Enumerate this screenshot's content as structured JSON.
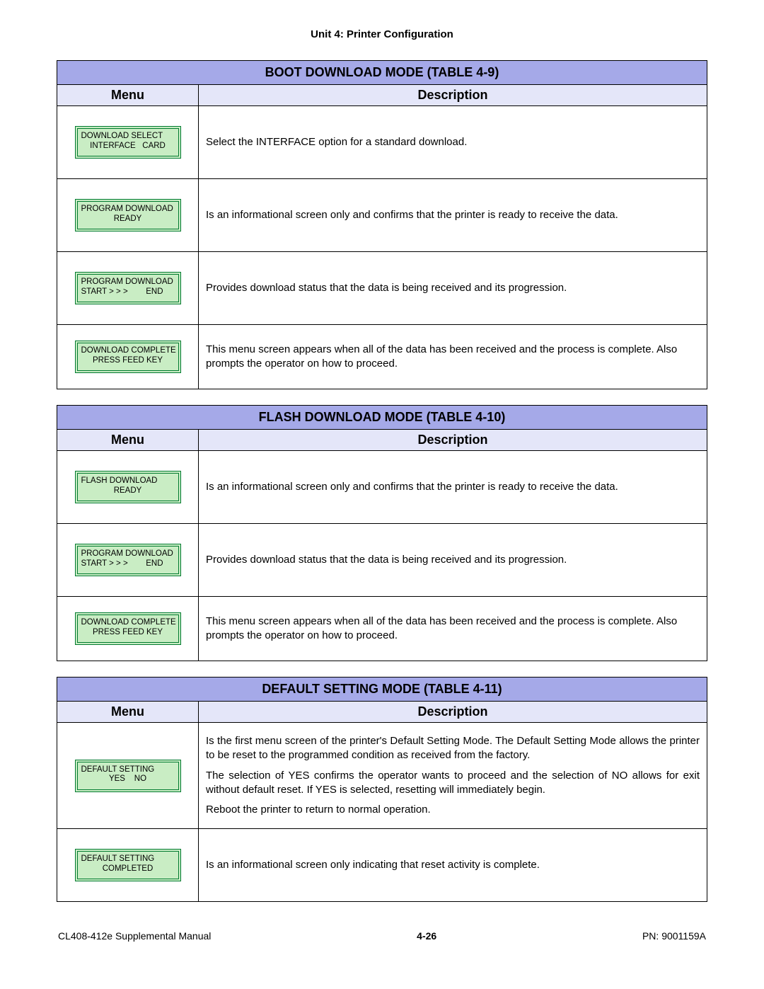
{
  "header": "Unit 4:  Printer Configuration",
  "tables": [
    {
      "title": "BOOT DOWNLOAD MODE (TABLE 4-9)",
      "menu_header": "Menu",
      "desc_header": "Description",
      "rows": [
        {
          "lcd_line1": "DOWNLOAD SELECT",
          "lcd_line2": "INTERFACE   CARD",
          "lcd_center": false,
          "l2_center": true,
          "tall": true,
          "desc": [
            "Select the INTERFACE option for a standard download."
          ]
        },
        {
          "lcd_line1": "PROGRAM DOWNLOAD",
          "lcd_line2": "READY",
          "lcd_center": false,
          "l2_center": true,
          "tall": true,
          "desc": [
            "Is an informational screen only and confirms that the printer is ready to receive the data."
          ]
        },
        {
          "lcd_line1": "PROGRAM DOWNLOAD",
          "lcd_line2": "START > > >        END",
          "lcd_center": false,
          "l2_center": false,
          "tall": true,
          "desc": [
            "Provides download status that the data is being received and its progression."
          ]
        },
        {
          "lcd_line1": "DOWNLOAD COMPLETE",
          "lcd_line2": "PRESS FEED KEY",
          "lcd_center": true,
          "l2_center": true,
          "tall": false,
          "desc": [
            "This menu screen appears when all of the data has been received and the process is complete. Also prompts the operator on how to proceed."
          ]
        }
      ]
    },
    {
      "title": "FLASH DOWNLOAD MODE (TABLE 4-10)",
      "menu_header": "Menu",
      "desc_header": "Description",
      "rows": [
        {
          "lcd_line1": "FLASH DOWNLOAD",
          "lcd_line2": "READY",
          "lcd_center": false,
          "l2_center": true,
          "tall": true,
          "desc": [
            "Is an informational screen only and confirms that the printer is ready to receive the data."
          ]
        },
        {
          "lcd_line1": "PROGRAM DOWNLOAD",
          "lcd_line2": "START > > >        END",
          "lcd_center": false,
          "l2_center": false,
          "tall": true,
          "desc": [
            "Provides download status that the data is being received and its progression."
          ]
        },
        {
          "lcd_line1": "DOWNLOAD COMPLETE",
          "lcd_line2": "PRESS FEED KEY",
          "lcd_center": true,
          "l2_center": true,
          "tall": false,
          "desc": [
            "This menu screen appears when all of the data has been received and the process is complete. Also prompts the operator on how to proceed."
          ]
        }
      ]
    },
    {
      "title": "DEFAULT SETTING MODE (TABLE 4-11)",
      "menu_header": "Menu",
      "desc_header": "Description",
      "rows": [
        {
          "lcd_line1": "DEFAULT SETTING",
          "lcd_line2": "YES    NO",
          "lcd_center": false,
          "l2_center": true,
          "tall": false,
          "justify": true,
          "desc": [
            "Is the first menu screen of the printer's Default Setting Mode. The Default Setting Mode allows the printer to be reset to the programmed condition as received from the factory.",
            "The selection of YES confirms the operator wants to proceed and the selection of NO allows for exit without default reset. If YES is selected, resetting will immediately begin.",
            "Reboot the printer to return to normal operation."
          ]
        },
        {
          "lcd_line1": "DEFAULT SETTING",
          "lcd_line2": "COMPLETED",
          "lcd_center": false,
          "l2_center": true,
          "tall": true,
          "desc": [
            "Is an informational screen only indicating that reset activity is complete."
          ]
        }
      ]
    }
  ],
  "footer": {
    "left": "CL408-412e Supplemental Manual",
    "center": "4-26",
    "right": "PN: 9001159A"
  }
}
